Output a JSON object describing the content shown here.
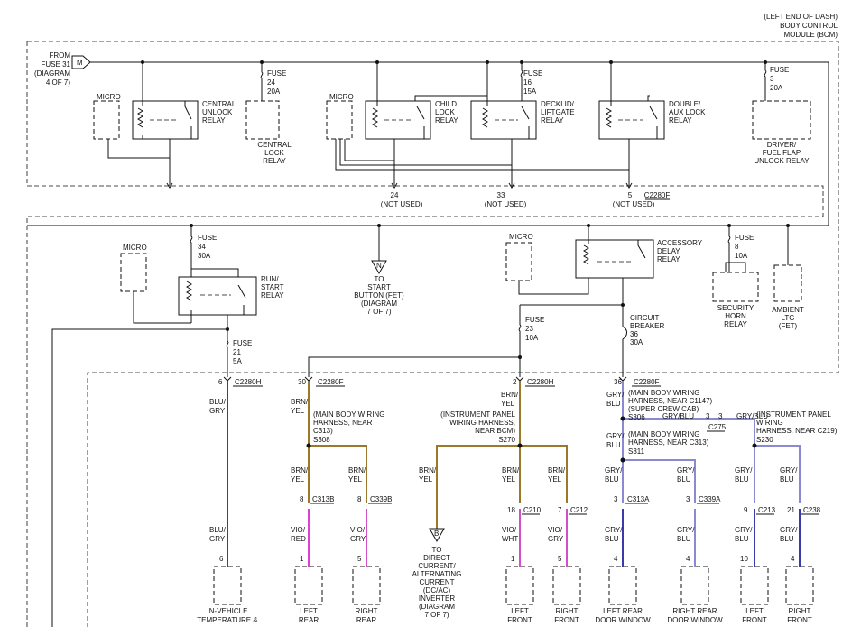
{
  "header": {
    "bcm": [
      "(LEFT END OF DASH)",
      "BODY CONTROL",
      "MODULE (BCM)"
    ]
  },
  "source": {
    "label": [
      "FROM",
      "FUSE 31",
      "(DIAGRAM",
      "4 OF 7)"
    ],
    "connector": "M"
  },
  "top": {
    "fuse24": [
      "FUSE",
      "24",
      "20A"
    ],
    "fuse16": [
      "FUSE",
      "16",
      "15A"
    ],
    "fuse3": [
      "FUSE",
      "3",
      "20A"
    ],
    "micro1": "MICRO",
    "micro2": "MICRO",
    "central_unlock": [
      "CENTRAL",
      "UNLOCK",
      "RELAY"
    ],
    "central_lock": [
      "CENTRAL",
      "LOCK",
      "RELAY"
    ],
    "child_lock": [
      "CHILD",
      "LOCK",
      "RELAY"
    ],
    "decklid": [
      "DECKLID/",
      "LIFTGATE",
      "RELAY"
    ],
    "double_aux": [
      "DOUBLE/",
      "AUX LOCK",
      "RELAY"
    ],
    "driver_fuel": [
      "DRIVER/",
      "FUEL FLAP",
      "UNLOCK RELAY"
    ],
    "pin24": "24",
    "pin33": "33",
    "pin5": "5",
    "not_used": "(NOT USED)",
    "c2280f": "C2280F"
  },
  "mid": {
    "micro3": "MICRO",
    "micro4": "MICRO",
    "fuse34": [
      "FUSE",
      "34",
      "30A"
    ],
    "run_start": [
      "RUN/",
      "START",
      "RELAY"
    ],
    "start_conn": "N",
    "start_button": [
      "TO",
      "START",
      "BUTTON (FET)",
      "(DIAGRAM",
      "7 OF 7)"
    ],
    "accessory_delay": [
      "ACCESSORY",
      "DELAY",
      "RELAY"
    ],
    "fuse8": [
      "FUSE",
      "8",
      "10A"
    ],
    "security_horn": [
      "SECURITY",
      "HORN",
      "RELAY"
    ],
    "ambient": [
      "AMBIENT",
      "LTG",
      "(FET)"
    ],
    "fuse23": [
      "FUSE",
      "23",
      "10A"
    ],
    "circuit_breaker": [
      "CIRCUIT",
      "BREAKER",
      "36",
      "30A"
    ],
    "fuse21": [
      "FUSE",
      "21",
      "5A"
    ]
  },
  "pins": {
    "p6": "6",
    "c2280h_a": "C2280H",
    "p30": "30",
    "c2280f_a": "C2280F",
    "p2": "2",
    "c2280h_b": "C2280H",
    "p36": "36",
    "c2280f_b": "C2280F"
  },
  "wires": {
    "blu_gry": [
      "BLU/",
      "GRY"
    ],
    "brn_yel": [
      "BRN/",
      "YEL"
    ],
    "gry_blu": [
      "GRY/",
      "BLU"
    ],
    "vio_red": [
      "VIO/",
      "RED"
    ],
    "vio_gry": [
      "VIO/",
      "GRY"
    ],
    "vio_wht": [
      "VIO/",
      "WHT"
    ],
    "gry_blu_inline": "GRY/BLU"
  },
  "harness": {
    "s308": [
      "(MAIN BODY WIRING",
      "HARNESS, NEAR",
      "C313)",
      "S308"
    ],
    "s270": [
      "(INSTRUMENT PANEL",
      "WIRING HARNESS,",
      "NEAR BCM)",
      "S270"
    ],
    "s306": [
      "(MAIN BODY WIRING",
      "HARNESS, NEAR C1147)",
      "(SUPER CREW CAB)",
      "S306"
    ],
    "s311": [
      "(MAIN BODY WIRING",
      "HARNESS, NEAR C313)",
      "S311"
    ],
    "s230": [
      "(INSTRUMENT PANEL",
      "WIRING",
      "HARNESS, NEAR C219)",
      "S230"
    ],
    "c275_pin": "3",
    "c275_pin2": "3",
    "c275": "C275"
  },
  "lower_conn": {
    "c313b": "C313B",
    "c339b": "C339B",
    "c210": "C210",
    "c212": "C212",
    "c313a": "C313A",
    "c339a": "C339A",
    "c213": "C213",
    "c238": "C238",
    "p8a": "8",
    "p8b": "8",
    "p18": "18",
    "p7": "7",
    "p3a": "3",
    "p3b": "3",
    "p9": "9",
    "p21": "21"
  },
  "dcac": {
    "conn": "B",
    "label": [
      "TO",
      "DIRECT",
      "CURRENT/",
      "ALTERNATING",
      "CURRENT",
      "(DC/AC)",
      "INVERTER",
      "(DIAGRAM",
      "7 OF 7)"
    ]
  },
  "loads": {
    "invehicle": {
      "pin": "6",
      "label": [
        "IN-VEHICLE",
        "TEMPERATURE &"
      ]
    },
    "left_rear": {
      "pin": "1",
      "label": [
        "LEFT",
        "REAR"
      ]
    },
    "right_rear": {
      "pin": "5",
      "label": [
        "RIGHT",
        "REAR"
      ]
    },
    "left_front": {
      "pin": "1",
      "label": [
        "LEFT",
        "FRONT"
      ]
    },
    "right_front": {
      "pin": "5",
      "label": [
        "RIGHT",
        "FRONT"
      ]
    },
    "lr_door": {
      "pin": "4",
      "label": [
        "LEFT REAR",
        "DOOR WINDOW"
      ]
    },
    "rr_door": {
      "pin": "4",
      "label": [
        "RIGHT REAR",
        "DOOR WINDOW"
      ]
    },
    "lf_front": {
      "pin": "10",
      "label": [
        "LEFT",
        "FRONT"
      ]
    },
    "rf_front": {
      "pin": "4",
      "label": [
        "RIGHT",
        "FRONT"
      ]
    }
  },
  "colors": {
    "wire": "#111111",
    "blu_gry": "#3a3aa8",
    "brn_yel": "#9a7a2a",
    "gry_blu": "#8a8ad0",
    "vio_red": "#e040d0",
    "vio": "#d050c8"
  }
}
